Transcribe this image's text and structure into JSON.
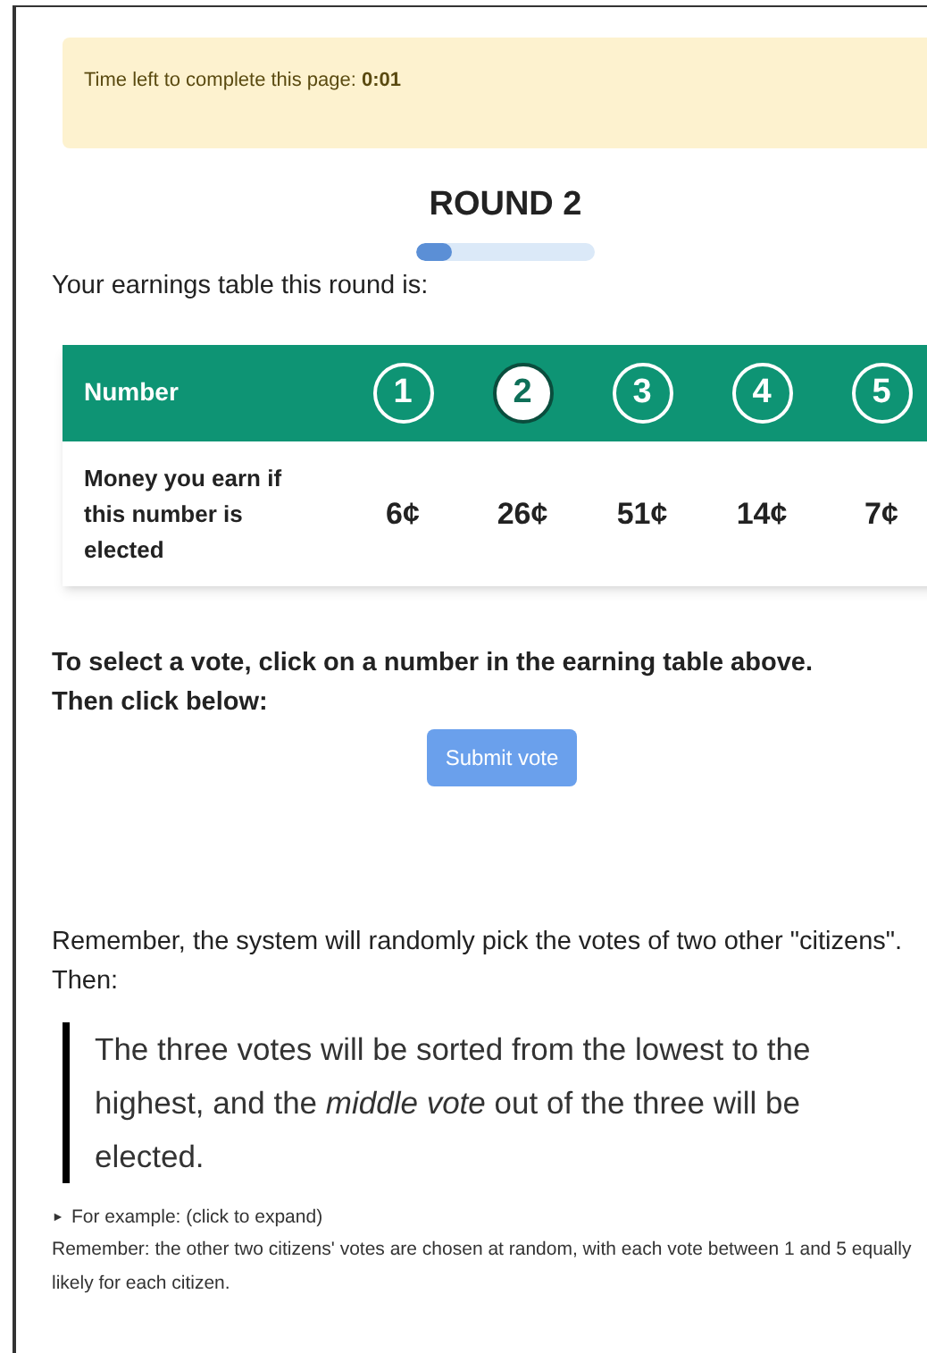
{
  "timer": {
    "label": "Time left to complete this page:",
    "value": "0:01"
  },
  "title": "ROUND 2",
  "progress": {
    "level": 0.2
  },
  "intro": "Your earnings table this round is:",
  "table": {
    "header_label": "Number",
    "row_label": "Money you earn if this number is elected",
    "options": [
      {
        "number": "1",
        "earning": "6¢",
        "selected": false
      },
      {
        "number": "2",
        "earning": "26¢",
        "selected": true
      },
      {
        "number": "3",
        "earning": "51¢",
        "selected": false
      },
      {
        "number": "4",
        "earning": "14¢",
        "selected": false
      },
      {
        "number": "5",
        "earning": "7¢",
        "selected": false
      }
    ]
  },
  "instruction": [
    "To select a vote, click on a number in the earning table above.",
    "Then click below:"
  ],
  "submit_button": "Submit vote",
  "reminder": "Remember, the system will randomly pick the votes of two other \"citizens\". Then:",
  "quote": "The three votes will be sorted from the lowest to the highest, and the *middle vote* out of the three will be elected.",
  "example": {
    "marker": "►",
    "label": "For example: (click to expand)",
    "expanded": false
  },
  "note": "Remember: the other two citizens' votes are chosen at random, with each vote between 1 and 5 equally likely for each citizen."
}
